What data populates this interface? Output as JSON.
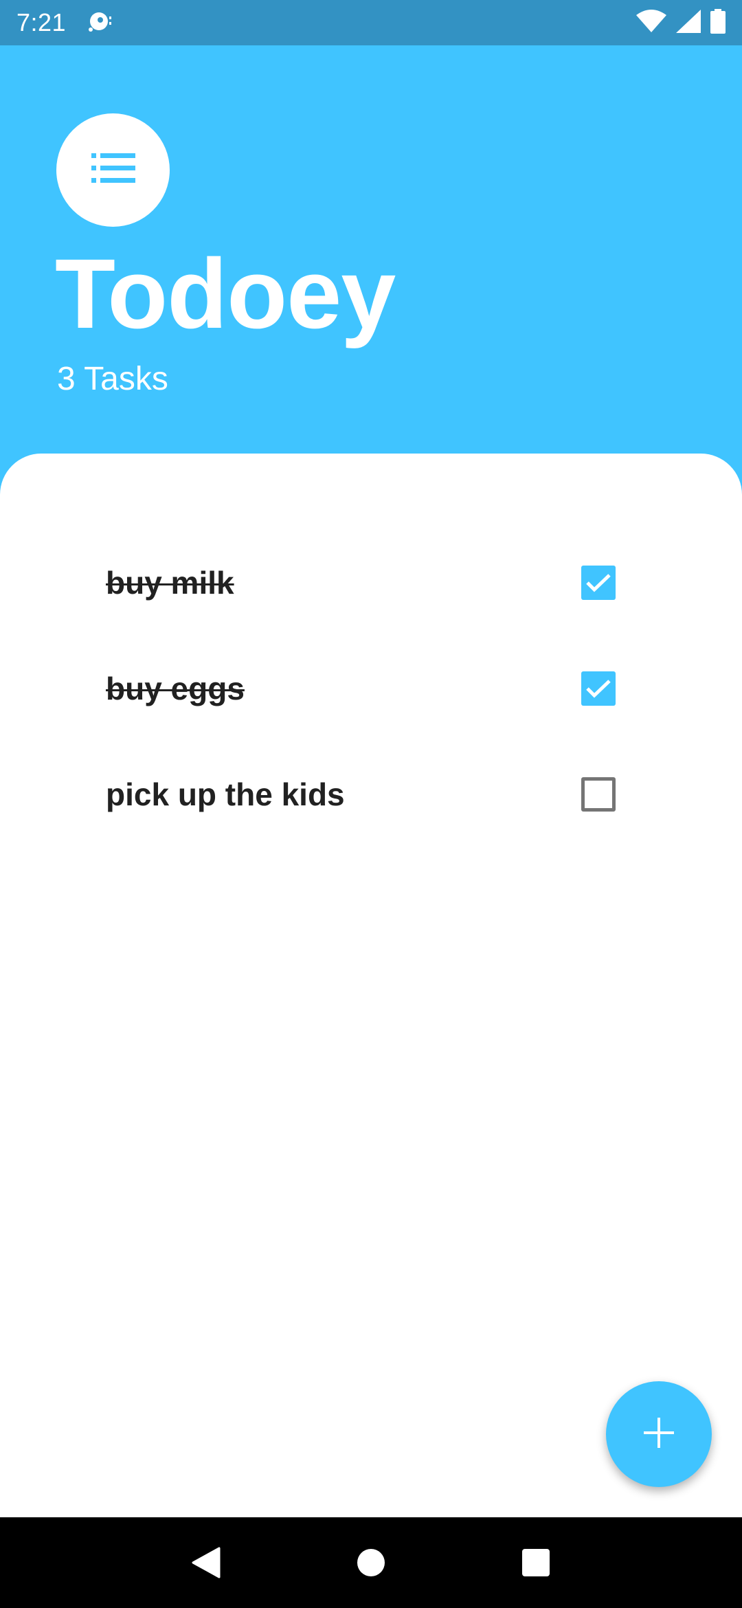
{
  "status_bar": {
    "time": "7:21",
    "icons": [
      "notification-icon",
      "wifi-icon",
      "signal-icon",
      "battery-icon"
    ]
  },
  "header": {
    "logo_icon": "list-icon",
    "title": "Todoey",
    "task_count": "3 Tasks"
  },
  "tasks": [
    {
      "label": "buy milk",
      "done": true
    },
    {
      "label": "buy eggs",
      "done": true
    },
    {
      "label": "pick up the kids",
      "done": false
    }
  ],
  "fab": {
    "icon": "plus-icon"
  },
  "nav_bar": {
    "buttons": [
      "back-icon",
      "home-icon",
      "recents-icon"
    ]
  },
  "colors": {
    "accent": "#40C4FF",
    "status_bar": "#3392C3",
    "text": "#212121"
  }
}
